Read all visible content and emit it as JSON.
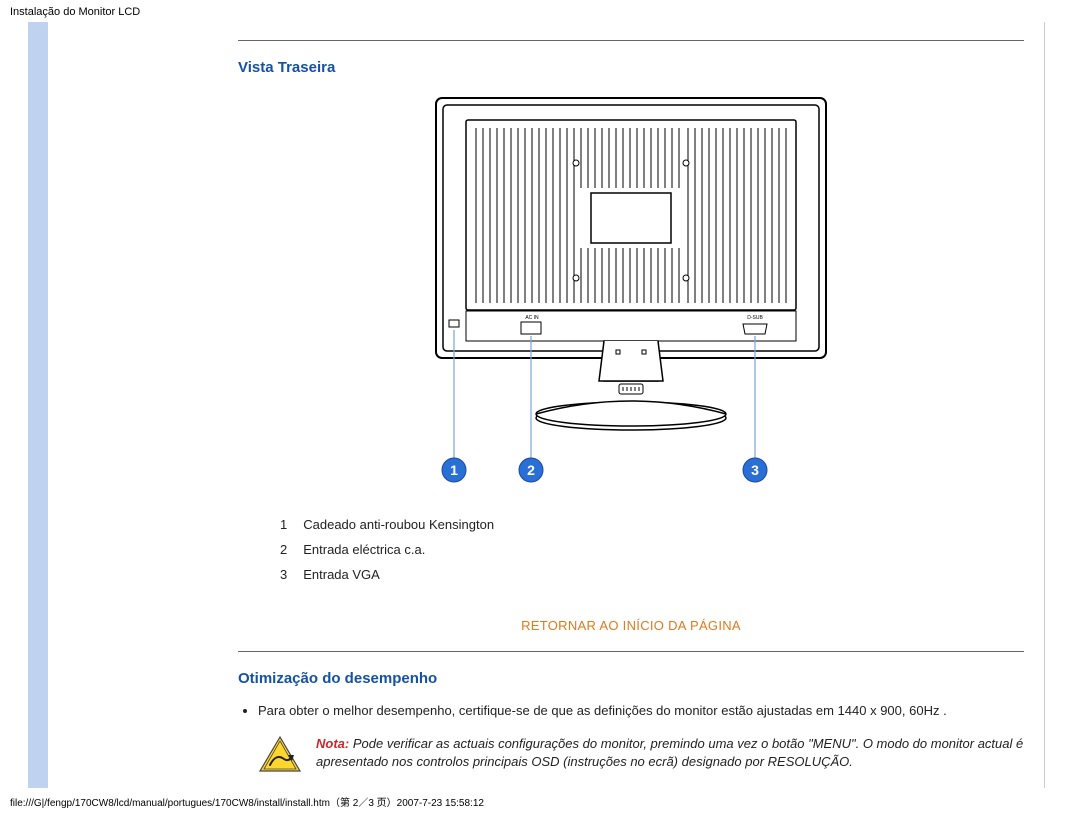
{
  "page_title": "Instalação do Monitor LCD",
  "sections": {
    "rear_view_heading": "Vista Traseira",
    "performance_heading": "Otimização do desempenho"
  },
  "figure": {
    "port_label_acin": "AC IN",
    "port_label_dsub": "D-SUB",
    "callouts": [
      "1",
      "2",
      "3"
    ]
  },
  "port_legend": [
    {
      "num": "1",
      "label": "Cadeado anti-roubou Kensington"
    },
    {
      "num": "2",
      "label": "Entrada eléctrica c.a."
    },
    {
      "num": "3",
      "label": "Entrada VGA"
    }
  ],
  "return_link": "RETORNAR AO INÍCIO DA PÁGINA",
  "performance_bullet": "Para obter o melhor desempenho, certifique-se de que as definições do monitor estão ajustadas em 1440 x 900, 60Hz .",
  "note": {
    "label": "Nota:",
    "body": "Pode verificar as actuais configurações do monitor, premindo uma vez o botão \"MENU\". O modo do monitor actual é apresentado nos controlos principais OSD (instruções no ecrã) designado por RESOLUÇÃO."
  },
  "footer_path": "file:///G|/fengp/170CW8/lcd/manual/portugues/170CW8/install/install.htm（第 2／3 页）2007-7-23 15:58:12"
}
